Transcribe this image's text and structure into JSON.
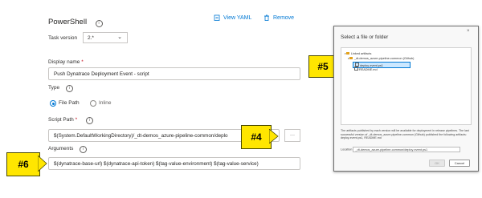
{
  "task": {
    "title": "PowerShell",
    "view_yaml": "View YAML",
    "remove": "Remove"
  },
  "task_version": {
    "label": "Task version",
    "value": "2.*"
  },
  "display_name": {
    "label": "Display name",
    "required": "*",
    "value": "Push Dynatrace Deployment Event - script"
  },
  "type": {
    "label": "Type",
    "options": [
      "File Path",
      "Inline"
    ],
    "selected": "File Path"
  },
  "script_path": {
    "label": "Script Path",
    "required": "*",
    "value": "$(System.DefaultWorkingDirectory)/_dt-demos_azure-pipeline-common/deplo",
    "browse": "···"
  },
  "arguments": {
    "label": "Arguments",
    "value": "$(dynatrace-base-url) $(dynatrace-api-token) $(tag-value-environment) $(tag-value-service)"
  },
  "callouts": {
    "four": "#4",
    "five": "#5",
    "six": "#6"
  },
  "dialog": {
    "title": "Select a file or folder",
    "close": "×",
    "tree": {
      "root": "Linked artifacts",
      "folder": "_dt-demos_azure-pipeline-common (Github)",
      "files": [
        "deploy-event.ps1",
        "README.md"
      ],
      "selected_file": "deploy-event.ps1"
    },
    "info": "The artifacts published by each version will be available for deployment in release pipelines. The last successful version of _dt-demos_azure-pipeline-common (Github) published the following artifacts: deploy-event.ps1, README.md",
    "location_label": "Location",
    "location_value": "_dt-demos_azure-pipeline-common/deploy-event.ps1",
    "ok": "OK",
    "cancel": "Cancel"
  },
  "colors": {
    "accent": "#0078d4",
    "callout": "#ffe600",
    "required": "#c50f1f",
    "selection": "#cce8ff"
  }
}
